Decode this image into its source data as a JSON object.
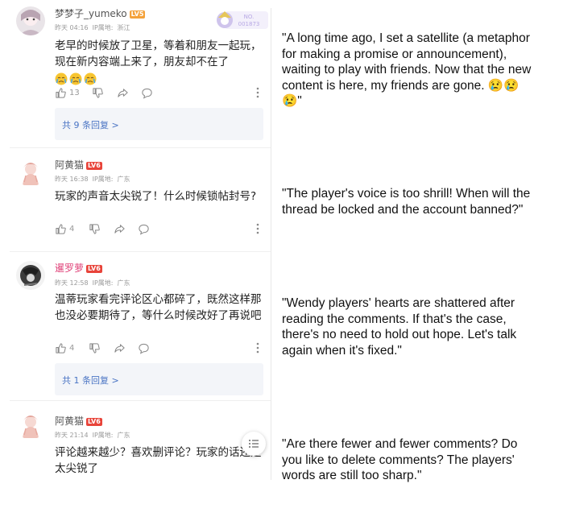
{
  "comments": [
    {
      "username": "梦梦子_yumeko",
      "level": "LV5",
      "time": "昨天 04:16",
      "ip_label": "IP属地:",
      "ip_location": "浙江",
      "text": "老早的时候放了卫星，等着和朋友一起玩，现在新内容端上来了，朋友却不在了",
      "emoji_count": 3,
      "likes": "13",
      "replies": "共 9 条回复 >",
      "badge_text": "NO.\n001873"
    },
    {
      "username": "阿黄猫",
      "level": "LV6",
      "time": "昨天 16:38",
      "ip_label": "IP属地:",
      "ip_location": "广东",
      "text": "玩家的声音太尖锐了！什么时候锁帖封号?",
      "likes": "4"
    },
    {
      "username": "暹罗萝",
      "level": "LV6",
      "time": "昨天 12:58",
      "ip_label": "IP属地:",
      "ip_location": "广东",
      "text": "温蒂玩家看完评论区心都碎了，既然这样那也没必要期待了，等什么时候改好了再说吧",
      "likes": "4",
      "replies": "共 1 条回复 >"
    },
    {
      "username": "阿黄猫",
      "level": "LV6",
      "time": "昨天 21:14",
      "ip_label": "IP属地:",
      "ip_location": "广东",
      "text": "评论越来越少？喜欢删评论？玩家的话还是太尖锐了"
    }
  ],
  "translations": [
    "\"A long time ago, I set a satellite (a metaphor for making a promise or announcement), waiting to play with friends. Now that the new content is here, my friends are gone. 😢😢😢\"",
    "\"The player's voice is too shrill! When will the thread be locked and the account banned?\"",
    "\"Wendy players' hearts are shattered after reading the comments. If that's the case, there's no need to hold out hope. Let's talk again when it's fixed.\"",
    "\"Are there fewer and fewer comments? Do you like to delete comments? The players' words are still too sharp.\""
  ],
  "colors": {
    "level5": "#f4a23b",
    "level6": "#e8443a",
    "reply_link": "#4a74c4",
    "pink_username": "#e0457b"
  }
}
